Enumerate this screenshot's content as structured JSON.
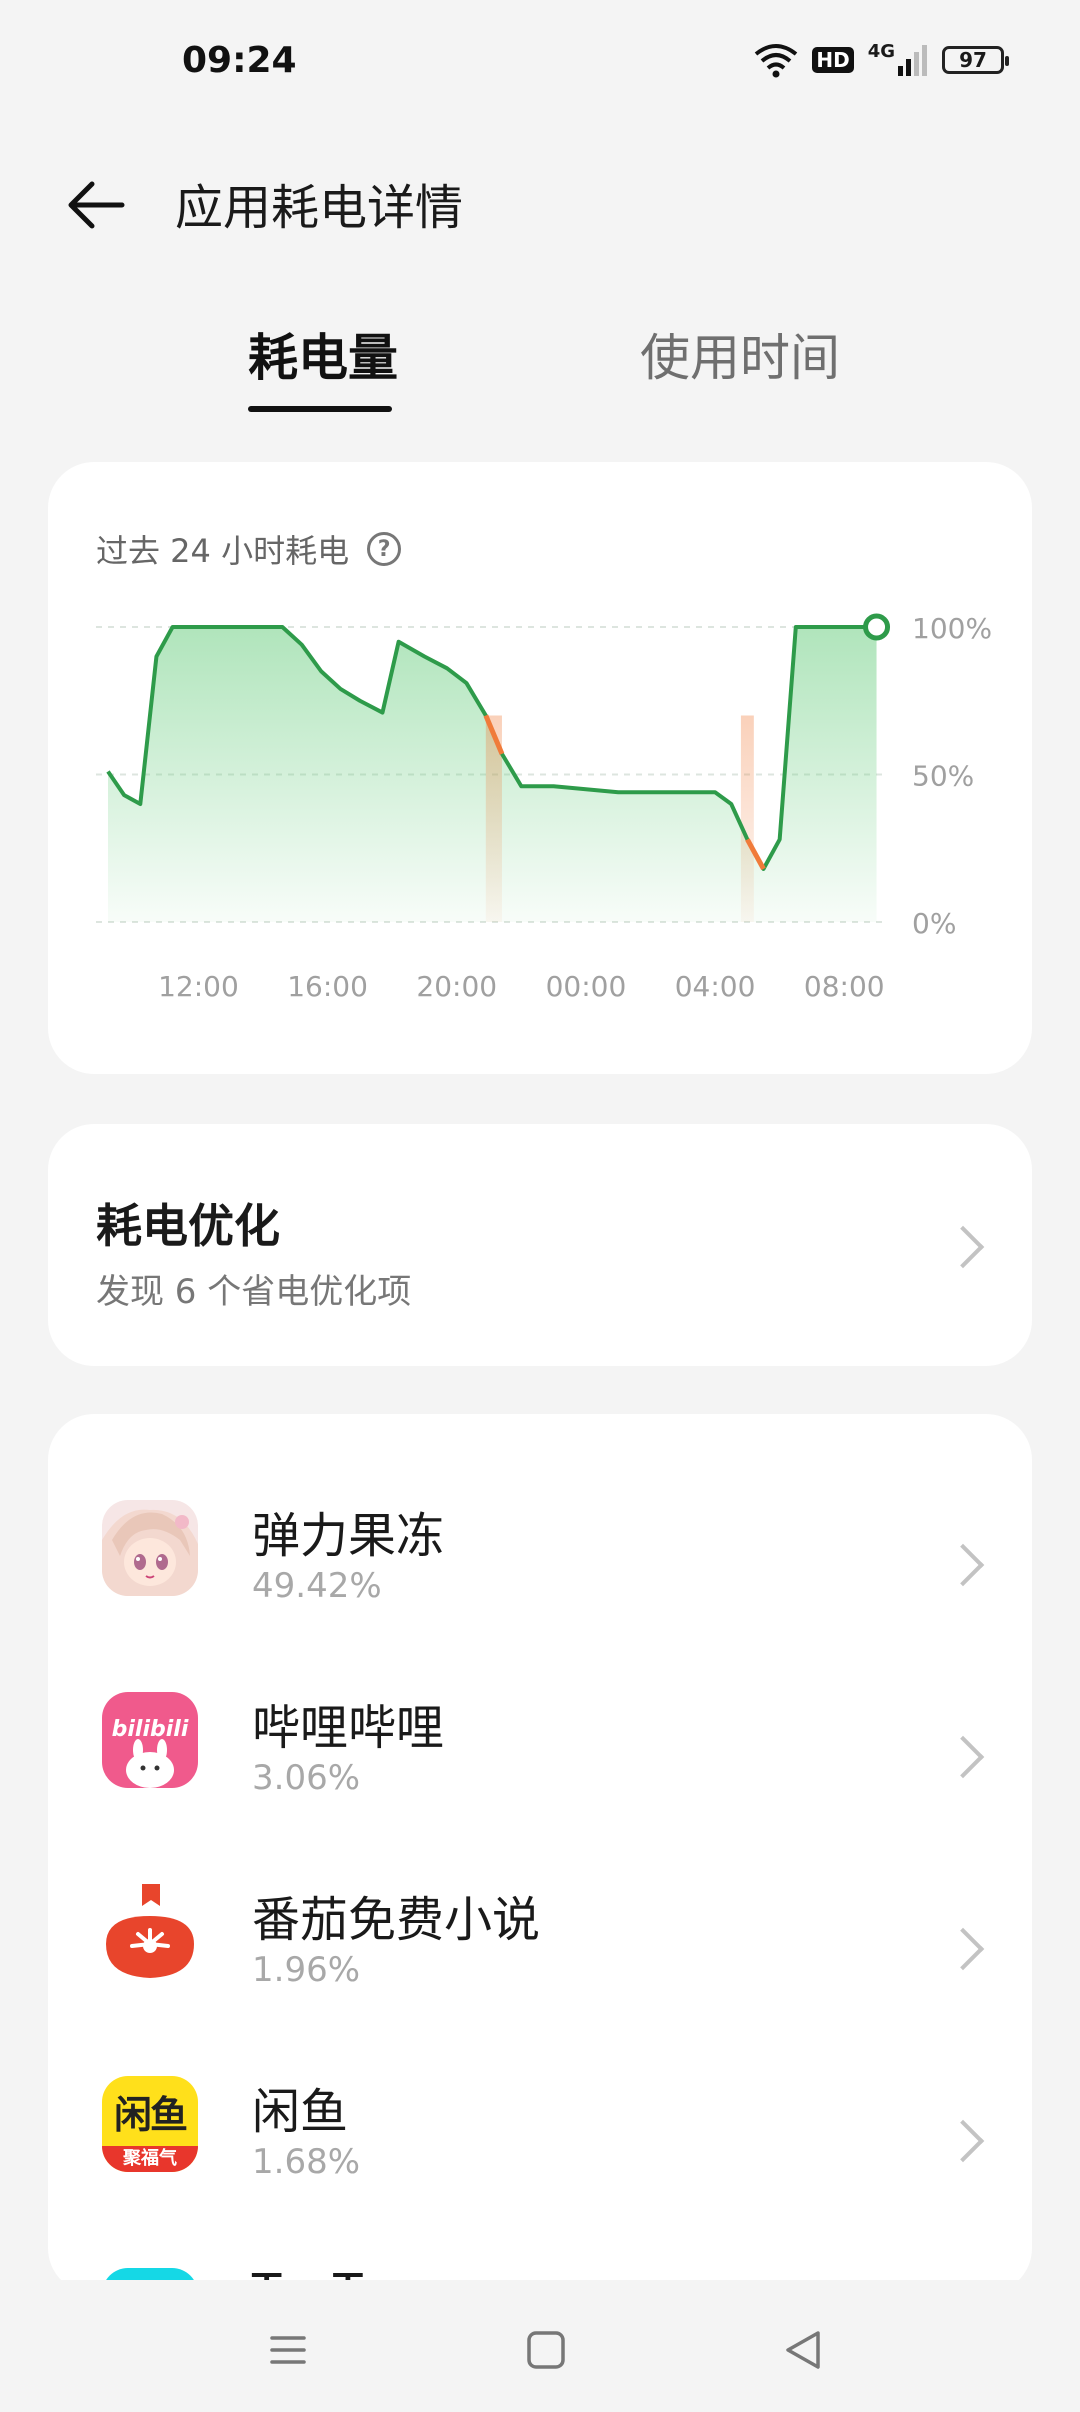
{
  "status_bar": {
    "time": "09:24",
    "network_badge": "HD",
    "network_type": "4G",
    "battery": "97"
  },
  "header": {
    "title": "应用耗电详情"
  },
  "tabs": [
    {
      "label": "耗电量",
      "active": true
    },
    {
      "label": "使用时间",
      "active": false
    }
  ],
  "chart_card": {
    "title": "过去 24 小时耗电",
    "icons": {
      "help": "question-circle-icon"
    }
  },
  "chart_data": {
    "type": "area",
    "title": "过去 24 小时耗电",
    "x_tick_labels": [
      "12:00",
      "16:00",
      "20:00",
      "00:00",
      "04:00",
      "08:00"
    ],
    "y_tick_labels": [
      "100%",
      "50%",
      "0%"
    ],
    "ylim": [
      0,
      100
    ],
    "xlim_hours": [
      9.2,
      33.2
    ],
    "x_unit": "hours since 00:00 of first day",
    "series": [
      {
        "x": [
          9.2,
          9.7,
          10.2,
          10.7,
          11.2,
          12.0,
          13.0,
          14.0,
          14.6,
          15.2,
          15.8,
          16.4,
          17.0,
          17.7,
          18.2,
          19.0,
          19.7,
          20.3,
          20.9,
          21.4,
          22.0,
          23.0,
          24.0,
          25.0,
          26.0,
          27.0,
          28.0,
          28.5,
          29.0,
          29.5,
          30.0,
          30.5,
          31.0,
          31.5,
          33.0
        ],
        "y": [
          51,
          43,
          40,
          90,
          100,
          100,
          100,
          100,
          100,
          94,
          85,
          79,
          75,
          71,
          95,
          90,
          86,
          81,
          70,
          57,
          46,
          46,
          45,
          44,
          44,
          44,
          44,
          40,
          28,
          18,
          28,
          100,
          100,
          100,
          100
        ]
      }
    ],
    "high_drain_segments": [
      [
        20.9,
        21.4
      ],
      [
        28.8,
        29.2
      ]
    ],
    "colors": {
      "line": "#2e9b4a",
      "fill": "#6fcf84",
      "high_drain": "#f07b3a",
      "grid": "#dde5df"
    },
    "grid": true
  },
  "optimization": {
    "title": "耗电优化",
    "subtitle": "发现 6 个省电优化项"
  },
  "apps": [
    {
      "name": "弹力果冻",
      "percent": "49.42%",
      "icon": "anime-girl-icon"
    },
    {
      "name": "哔哩哔哩",
      "percent": "3.06%",
      "icon": "bilibili-icon"
    },
    {
      "name": "番茄免费小说",
      "percent": "1.96%",
      "icon": "tomato-icon"
    },
    {
      "name": "闲鱼",
      "percent": "1.68%",
      "icon": "xianyu-icon",
      "icon_text": "闲鱼",
      "icon_badge": "聚福气"
    },
    {
      "name": "TapTap",
      "percent": "",
      "icon": "taptap-icon"
    }
  ],
  "navbar": {
    "icons": [
      "menu-icon",
      "home-icon",
      "back-icon"
    ]
  }
}
